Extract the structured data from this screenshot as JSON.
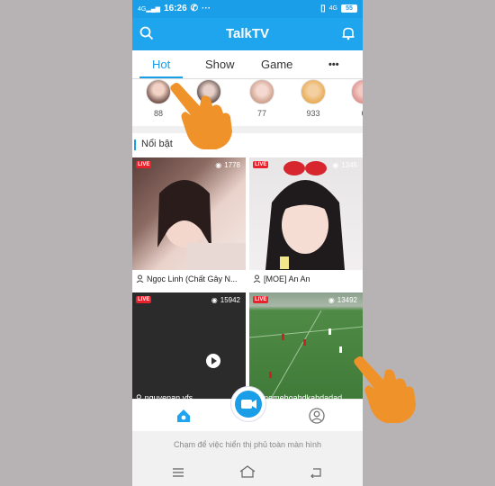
{
  "status_bar": {
    "time": "16:26",
    "network": "4G",
    "battery": "55"
  },
  "app_bar": {
    "title": "TalkTV"
  },
  "tabs": [
    {
      "label": "Hot"
    },
    {
      "label": "Show"
    },
    {
      "label": "Game"
    },
    {
      "label": "•••"
    }
  ],
  "avatars": [
    {
      "count": "88"
    },
    {
      "count": ""
    },
    {
      "count": "77"
    },
    {
      "count": "933"
    },
    {
      "count": "6"
    }
  ],
  "section": {
    "title": "Nổi bật"
  },
  "streams": [
    {
      "live": "LIVE",
      "views": "1778",
      "caption": "Ngọc Linh (Chất Gây N..."
    },
    {
      "live": "LIVE",
      "views": "1345",
      "caption": "[MOE] An An"
    },
    {
      "live": "LIVE",
      "views": "15942",
      "caption": "nguyenan.vfs"
    },
    {
      "live": "LIVE",
      "views": "13492",
      "caption": "memehoahdkahdadad"
    }
  ],
  "hint": "Chạm để việc hiển thị phủ toàn màn hình",
  "colors": {
    "accent": "#1fa4ee",
    "live": "#e8212b",
    "hand": "#f0922a"
  }
}
